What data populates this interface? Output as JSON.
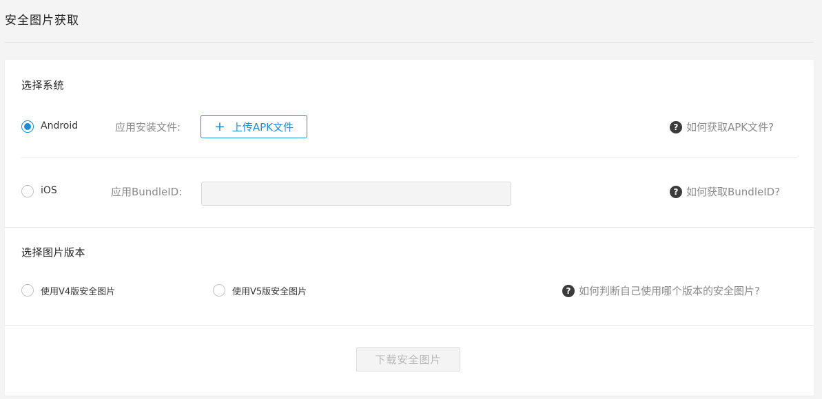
{
  "page": {
    "title": "安全图片获取"
  },
  "system_section": {
    "heading": "选择系统",
    "android": {
      "label": "Android",
      "selected": true,
      "field_label": "应用安装文件:",
      "upload_label": "上传APK文件",
      "upload_icon": "plus-icon",
      "help_text": "如何获取APK文件?"
    },
    "ios": {
      "label": "iOS",
      "selected": false,
      "field_label": "应用BundleID:",
      "input_value": "",
      "input_placeholder": "",
      "help_text": "如何获取BundleID?"
    }
  },
  "version_section": {
    "heading": "选择图片版本",
    "options": [
      {
        "label": "使用V4版安全图片",
        "selected": false
      },
      {
        "label": "使用V5版安全图片",
        "selected": false
      }
    ],
    "help_text": "如何判断自己使用哪个版本的安全图片?"
  },
  "actions": {
    "download_label": "下载安全图片",
    "download_enabled": false
  },
  "colors": {
    "accent": "#1a8fd8",
    "help_icon": "#3b3b3b",
    "muted_text": "#8a8a8a"
  }
}
